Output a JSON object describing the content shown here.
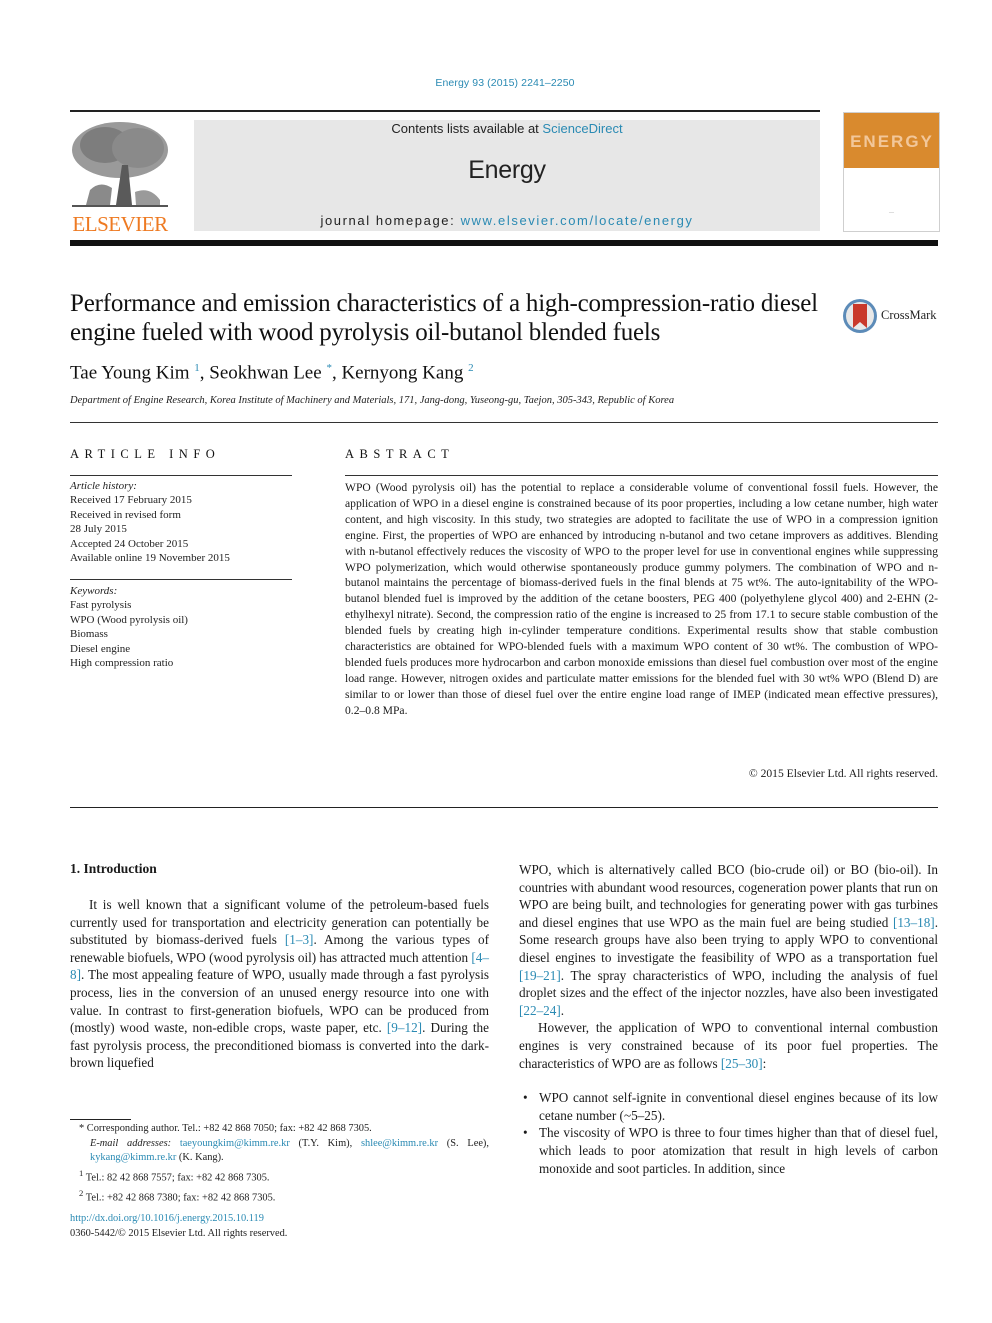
{
  "header": {
    "citation": "Energy 93 (2015) 2241–2250",
    "contents_prefix": "Contents lists available at ",
    "contents_link": "ScienceDirect",
    "journal_name": "Energy",
    "homepage_prefix": "journal homepage: ",
    "homepage_link": "www.elsevier.com/locate/energy",
    "publisher_logo_text": "ELSEVIER",
    "cover_title": "ENERGY",
    "crossmark_label": "CrossMark",
    "colors": {
      "link": "#2a8ab3",
      "elsevier_orange": "#ee7a22",
      "cover_orange": "#d98a2e",
      "banner_gray": "#e7e7e7"
    }
  },
  "article": {
    "title": "Performance and emission characteristics of a high-compression-ratio diesel engine fueled with wood pyrolysis oil-butanol blended fuels",
    "authors": [
      {
        "name": "Tae Young Kim",
        "mark": "1",
        "sep": ", "
      },
      {
        "name": "Seokhwan Lee",
        "mark": "*",
        "sep": ", "
      },
      {
        "name": "Kernyong Kang",
        "mark": "2",
        "sep": ""
      }
    ],
    "affiliation": "Department of Engine Research, Korea Institute of Machinery and Materials, 171, Jang-dong, Yuseong-gu, Taejon, 305-343, Republic of Korea"
  },
  "article_info": {
    "caption": "ARTICLE INFO",
    "history_label": "Article history:",
    "history": [
      "Received 17 February 2015",
      "Received in revised form",
      "28 July 2015",
      "Accepted 24 October 2015",
      "Available online 19 November 2015"
    ],
    "keywords_label": "Keywords:",
    "keywords": [
      "Fast pyrolysis",
      "WPO (Wood pyrolysis oil)",
      "Biomass",
      "Diesel engine",
      "High compression ratio"
    ]
  },
  "abstract": {
    "caption": "ABSTRACT",
    "text": "WPO (Wood pyrolysis oil) has the potential to replace a considerable volume of conventional fossil fuels. However, the application of WPO in a diesel engine is constrained because of its poor properties, including a low cetane number, high water content, and high viscosity. In this study, two strategies are adopted to facilitate the use of WPO in a compression ignition engine. First, the properties of WPO are enhanced by introducing n-butanol and two cetane improvers as additives. Blending with n-butanol effectively reduces the viscosity of WPO to the proper level for use in conventional engines while suppressing WPO polymerization, which would otherwise spontaneously produce gummy polymers. The combination of WPO and n-butanol maintains the percentage of biomass-derived fuels in the final blends at 75 wt%. The auto-ignitability of the WPO-butanol blended fuel is improved by the addition of the cetane boosters, PEG 400 (polyethylene glycol 400) and 2-EHN (2-ethylhexyl nitrate). Second, the compression ratio of the engine is increased to 25 from 17.1 to secure stable combustion of the blended fuels by creating high in-cylinder temperature conditions. Experimental results show that stable combustion characteristics are obtained for WPO-blended fuels with a maximum WPO content of 30 wt%. The combustion of WPO-blended fuels produces more hydrocarbon and carbon monoxide emissions than diesel fuel combustion over most of the engine load range. However, nitrogen oxides and particulate matter emissions for the blended fuel with 30 wt% WPO (Blend D) are similar to or lower than those of diesel fuel over the entire engine load range of IMEP (indicated mean effective pressures), 0.2–0.8 MPa.",
    "copyright": "© 2015 Elsevier Ltd. All rights reserved."
  },
  "body": {
    "section_heading": "1.  Introduction",
    "left_paragraph": [
      {
        "t": "It is well known that a significant volume of the petroleum-based fuels currently used for transportation and electricity generation can potentially be substituted by biomass-derived fuels "
      },
      {
        "ref": "[1–3]"
      },
      {
        "t": ". Among the various types of renewable biofuels, WPO (wood pyrolysis oil) has attracted much attention "
      },
      {
        "ref": "[4–8]"
      },
      {
        "t": ". The most appealing feature of WPO, usually made through a fast pyrolysis process, lies in the conversion of an unused energy resource into one with value. In contrast to first-generation biofuels, WPO can be produced from (mostly) wood waste, non-edible crops, waste paper, etc. "
      },
      {
        "ref": "[9–12]"
      },
      {
        "t": ". During the fast pyrolysis process, the preconditioned biomass is converted into the dark-brown liquefied"
      }
    ],
    "right_paragraph_1": [
      {
        "t": "WPO, which is alternatively called BCO (bio-crude oil) or BO (bio-oil). In countries with abundant wood resources, cogeneration power plants that run on WPO are being built, and technologies for generating power with gas turbines and diesel engines that use WPO as the main fuel are being studied "
      },
      {
        "ref": "[13–18]"
      },
      {
        "t": ". Some research groups have also been trying to apply WPO to conventional diesel engines to investigate the feasibility of WPO as a transportation fuel "
      },
      {
        "ref": "[19–21]"
      },
      {
        "t": ". The spray characteristics of WPO, including the analysis of fuel droplet sizes and the effect of the injector nozzles, have also been investigated "
      },
      {
        "ref": "[22–24]"
      },
      {
        "t": "."
      }
    ],
    "right_paragraph_2": [
      {
        "t": "However, the application of WPO to conventional internal combustion engines is very constrained because of its poor fuel properties. The characteristics of WPO are as follows "
      },
      {
        "ref": "[25–30]"
      },
      {
        "t": ":"
      }
    ],
    "bullets": [
      "WPO cannot self-ignite in conventional diesel engines because of its low cetane number (~5–25).",
      "The viscosity of WPO is three to four times higher than that of diesel fuel, which leads to poor atomization that result in high levels of carbon monoxide and soot particles. In addition, since"
    ]
  },
  "footnotes": {
    "corresponding": "*  Corresponding author. Tel.: +82 42 868 7050; fax: +82 42 868 7305.",
    "email_label": "E-mail addresses:",
    "emails": [
      {
        "addr": "taeyoungkim@kimm.re.kr",
        "who": " (T.Y. Kim), "
      },
      {
        "addr": "shlee@kimm.re.kr",
        "who": " (S. Lee), "
      },
      {
        "addr": "kykang@kimm.re.kr",
        "who": " (K. Kang)."
      }
    ],
    "fn1_mark": "1",
    "fn1": " Tel.: 82 42 868 7557; fax: +82 42 868 7305.",
    "fn2_mark": "2",
    "fn2": " Tel.: +82 42 868 7380; fax: +82 42 868 7305.",
    "doi": "http://dx.doi.org/10.1016/j.energy.2015.10.119",
    "issn": "0360-5442/© 2015 Elsevier Ltd. All rights reserved."
  }
}
